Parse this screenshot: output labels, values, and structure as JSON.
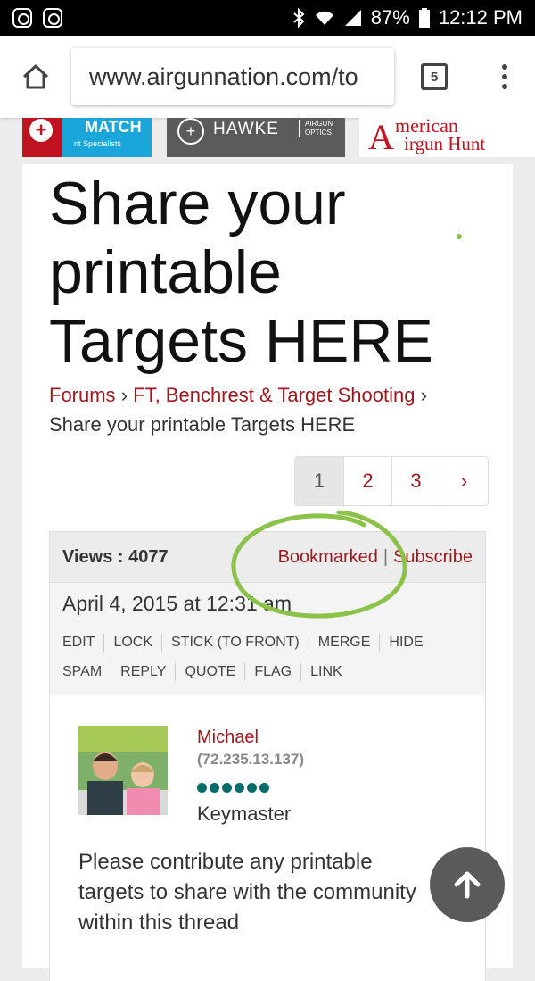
{
  "status": {
    "battery": "87%",
    "time": "12:12 PM"
  },
  "browser": {
    "url": "www.airgunnation.com/to",
    "tab_count": "5"
  },
  "ads": {
    "ad1_title": "MATCH",
    "ad1_sub": "nt Specialists",
    "ad2_title": "HAWKE",
    "ad2_sub1": "AIRGUN",
    "ad2_sub2": "OPTICS",
    "ad3_line1": "merican",
    "ad3_line2": "irgun Hunt",
    "ad3_initial": "A"
  },
  "page": {
    "title": "Share your printable Targets HERE",
    "breadcrumb": {
      "forums": "Forums",
      "sep": "›",
      "category": "FT, Benchrest & Target Shooting",
      "current": "Share your printable Targets HERE"
    }
  },
  "pagination": {
    "pages": [
      "1",
      "2",
      "3"
    ],
    "next": "›"
  },
  "topic": {
    "views": "Views : 4077",
    "bookmarked": "Bookmarked",
    "divider": "|",
    "subscribe": "Subscribe",
    "date": "April 4, 2015 at 12:31 am",
    "actions": [
      "EDIT",
      "LOCK",
      "STICK (TO FRONT)",
      "MERGE",
      "HIDE",
      "SPAM",
      "REPLY",
      "QUOTE",
      "FLAG",
      "LINK"
    ]
  },
  "post": {
    "author": "Michael",
    "ip": "(72.235.13.137)",
    "role": "Keymaster",
    "body": "Please contribute any printable targets to share with the community within this thread"
  },
  "colors": {
    "link": "#a0181e",
    "annotation": "#8bc34a",
    "rank_dots": "#006d6b"
  }
}
